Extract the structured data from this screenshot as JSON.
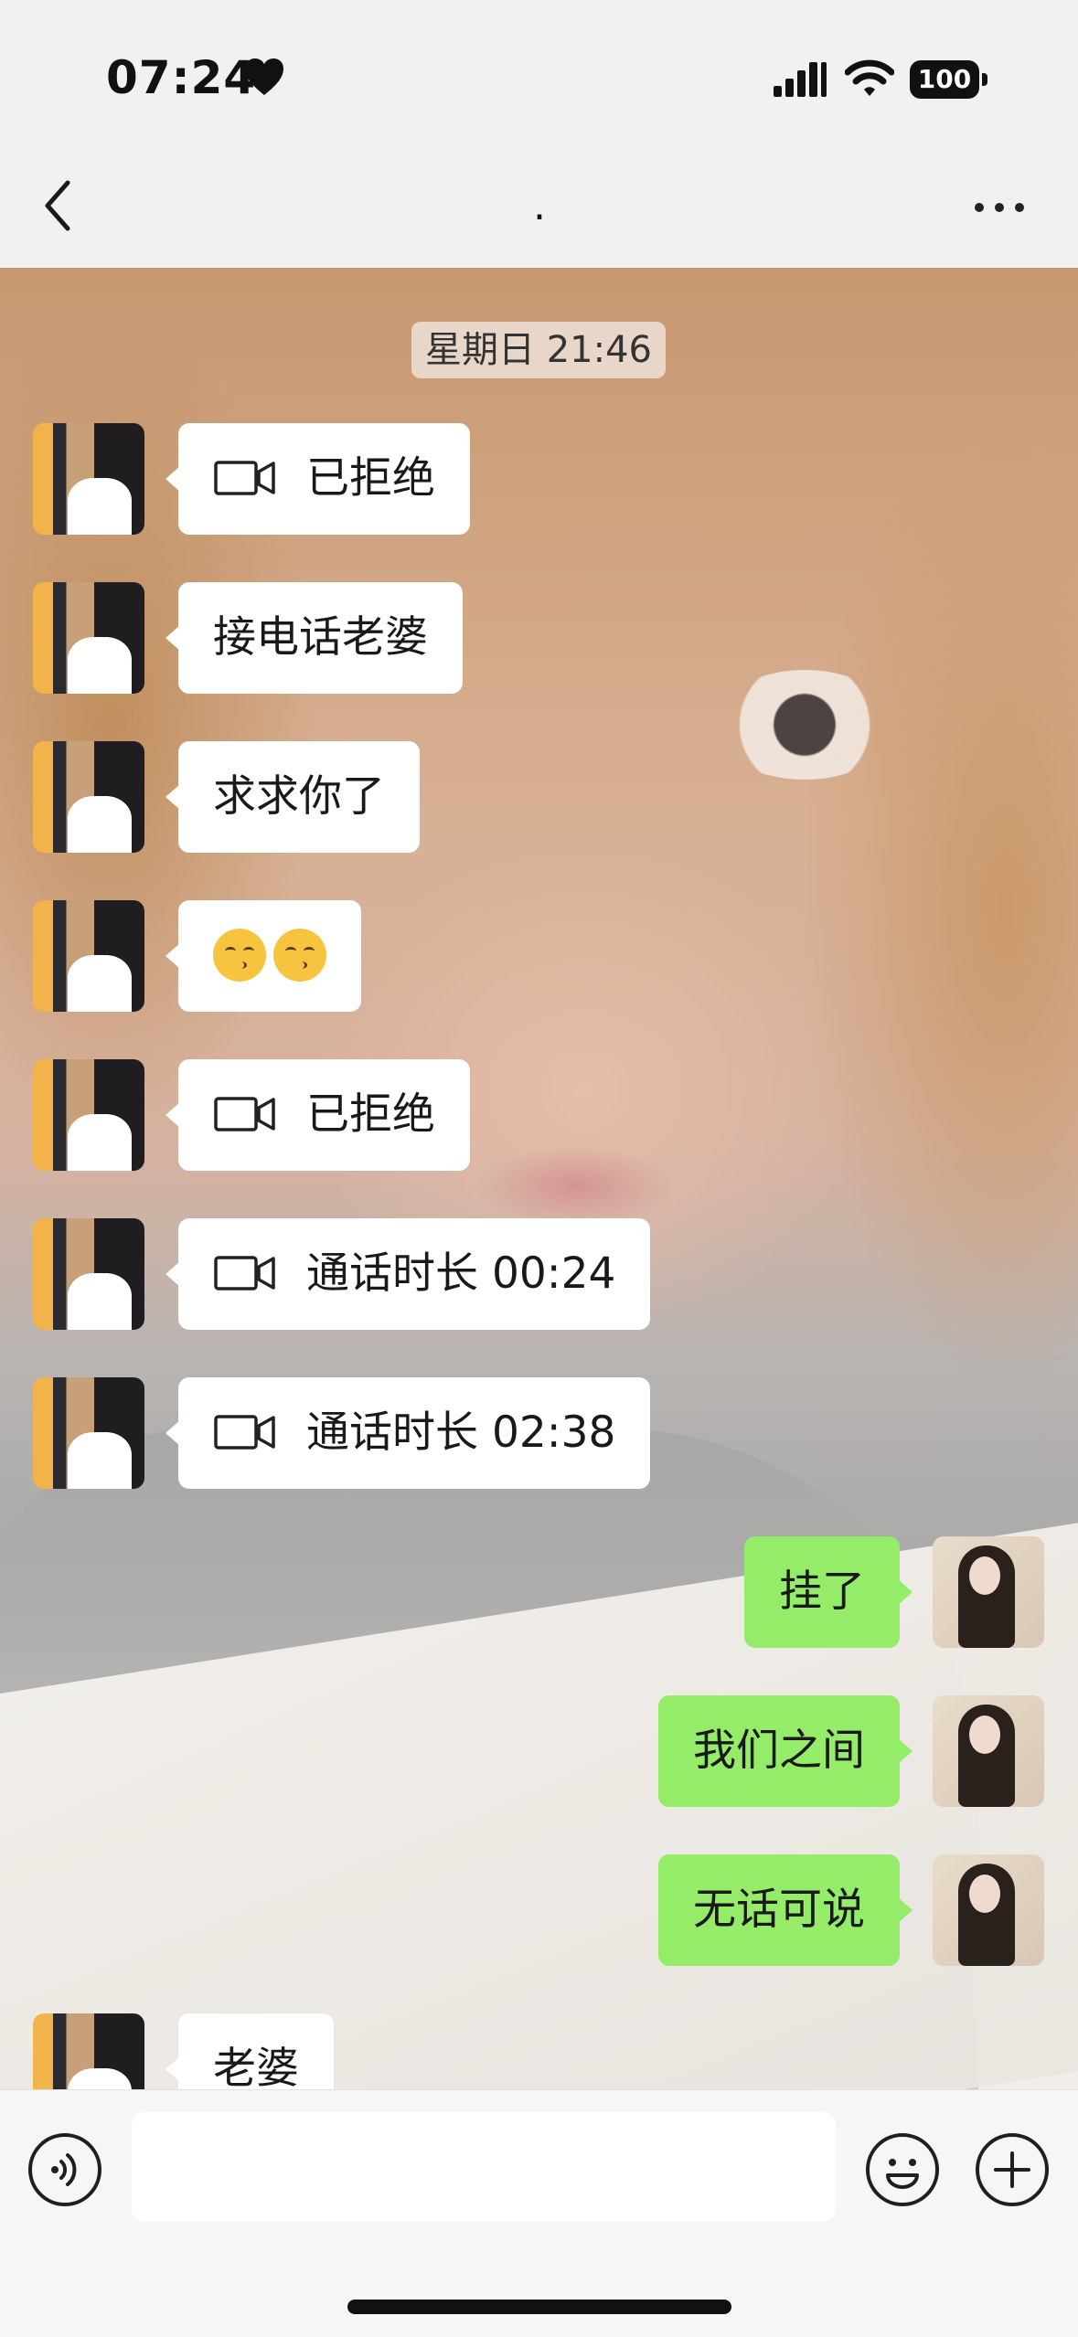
{
  "status_bar": {
    "time": "07:24",
    "battery": "100"
  },
  "header": {
    "title": "."
  },
  "chat": {
    "timestamp": "星期日 21:46",
    "messages": [
      {
        "side": "left",
        "type": "video_call",
        "text": "已拒绝"
      },
      {
        "side": "left",
        "type": "text",
        "text": "接电话老婆"
      },
      {
        "side": "left",
        "type": "text",
        "text": "求求你了"
      },
      {
        "side": "left",
        "type": "emoji",
        "icons": [
          "kissing-face-smiling-eyes",
          "kissing-face-smiling-eyes"
        ]
      },
      {
        "side": "left",
        "type": "video_call",
        "text": "已拒绝"
      },
      {
        "side": "left",
        "type": "video_call",
        "text": "通话时长 00:24"
      },
      {
        "side": "left",
        "type": "video_call",
        "text": "通话时长 02:38"
      },
      {
        "side": "right",
        "type": "text",
        "text": "挂了"
      },
      {
        "side": "right",
        "type": "text",
        "text": "我们之间"
      },
      {
        "side": "right",
        "type": "text",
        "text": "无话可说"
      },
      {
        "side": "left",
        "type": "text",
        "text": "老婆"
      }
    ]
  },
  "input_bar": {
    "value": ""
  },
  "colors": {
    "sent_bubble": "#95ec69",
    "received_bubble": "#ffffff"
  }
}
